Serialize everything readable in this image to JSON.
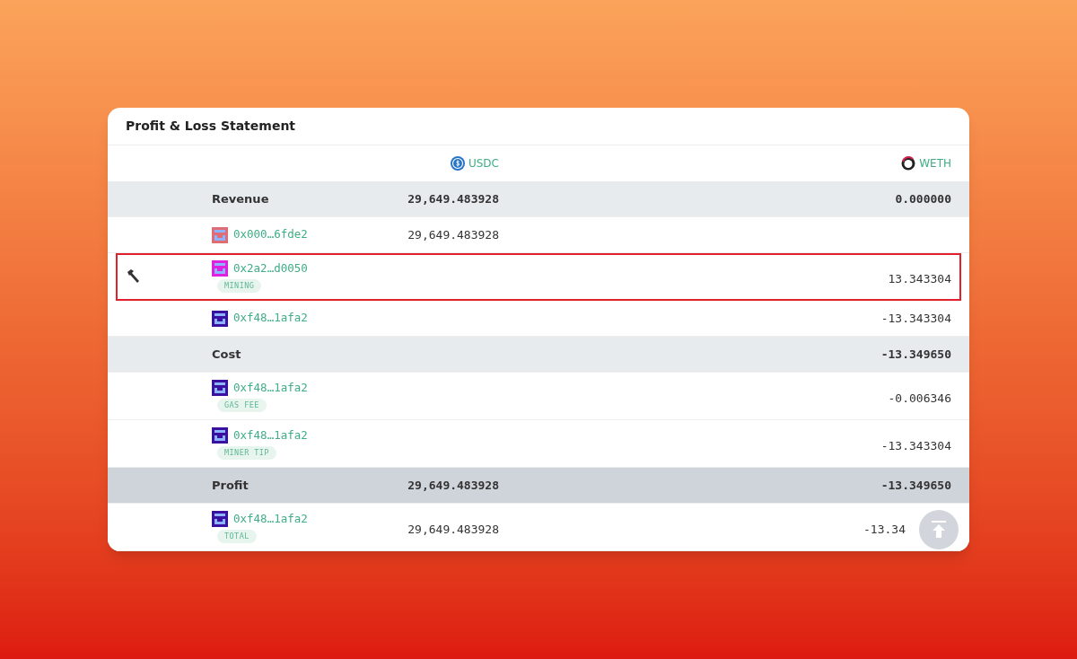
{
  "card": {
    "title": "Profit & Loss Statement"
  },
  "columns": [
    {
      "symbol": "USDC",
      "kind": "usdc"
    },
    {
      "symbol": "WETH",
      "kind": "weth"
    }
  ],
  "rows": [
    {
      "kind": "section",
      "label": "Revenue",
      "usdc": "29,649.483928",
      "weth": "0.000000"
    },
    {
      "kind": "address",
      "address": "0x000…6fde2",
      "color": "#e06c75",
      "usdc": "29,649.483928",
      "highlighted": false
    },
    {
      "kind": "address",
      "address": "0x2a2…d0050",
      "color": "#e020e0",
      "tag": "MINING",
      "weth": "13.343304",
      "highlighted": true
    },
    {
      "kind": "address",
      "address": "0xf48…1afa2",
      "color": "#3a10a0",
      "weth": "-13.343304",
      "highlighted": false
    },
    {
      "kind": "section",
      "label": "Cost",
      "weth": "-13.349650"
    },
    {
      "kind": "address",
      "address": "0xf48…1afa2",
      "color": "#3a10a0",
      "tag": "GAS FEE",
      "weth": "-0.006346",
      "highlighted": false
    },
    {
      "kind": "address",
      "address": "0xf48…1afa2",
      "color": "#3a10a0",
      "tag": "MINER TIP",
      "weth": "-13.343304",
      "highlighted": false
    },
    {
      "kind": "total",
      "label": "Profit",
      "usdc": "29,649.483928",
      "weth": "-13.349650"
    },
    {
      "kind": "address",
      "address": "0xf48…1afa2",
      "color": "#3a10a0",
      "tag": "TOTAL",
      "usdc": "29,649.483928",
      "weth": "-13.34",
      "highlighted": false
    }
  ]
}
